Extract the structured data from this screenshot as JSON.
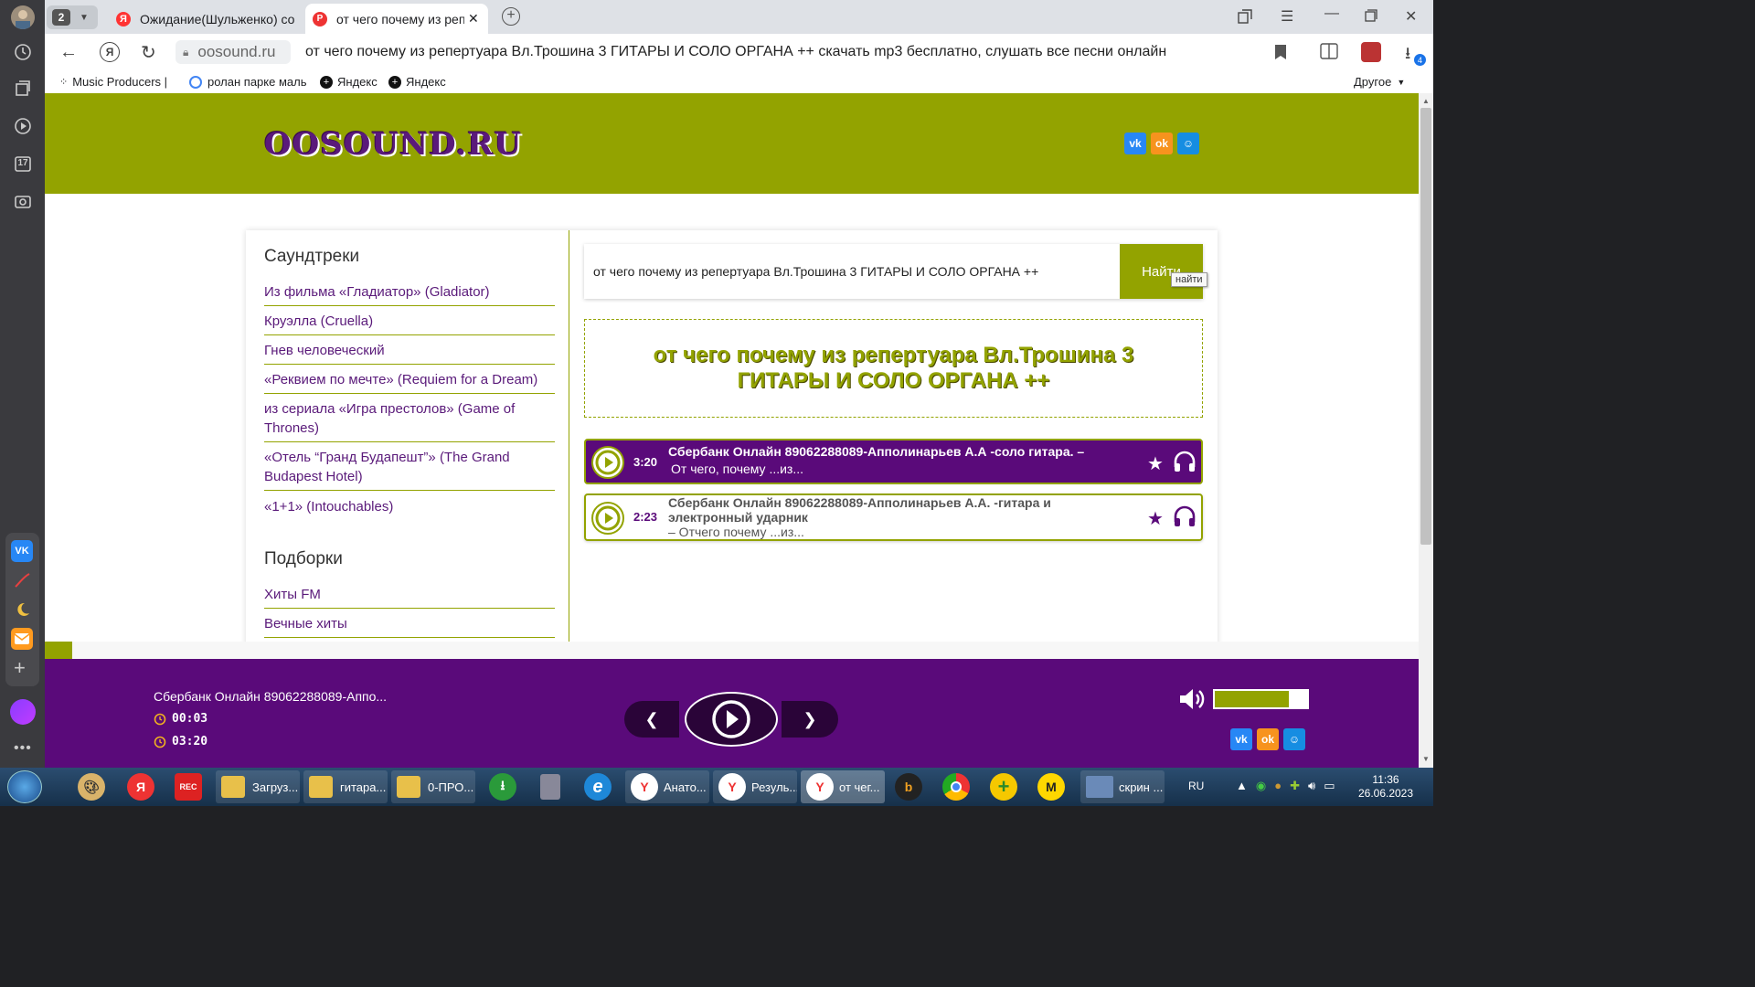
{
  "browser": {
    "tab_count": "2",
    "tabs": [
      {
        "title": "Ожидание(Шульженко) со"
      },
      {
        "title": "от чего почему из репе"
      }
    ],
    "url_domain": "oosound.ru",
    "page_title": "от чего почему из репертуара Вл.Трошина 3 ГИТАРЫ И СОЛО ОРГАНА ++ скачать mp3 бесплатно, слушать все песни онлайн",
    "bookmarks": [
      {
        "label": "Music Producers |"
      },
      {
        "label": "ролан парке маль"
      },
      {
        "label": "Яндекс"
      },
      {
        "label": "Яндекс"
      }
    ],
    "bookmarks_other": "Другое",
    "downloads_badge": "4",
    "sidebar_calendar": "17"
  },
  "site": {
    "logo": "OOSOUND.RU",
    "social": {
      "vk": "vk",
      "ok": "ok",
      "mail": "mail"
    },
    "sections": [
      {
        "title": "Саундтреки",
        "items": [
          "Из фильма «Гладиатор» (Gladiator)",
          "Круэлла (Cruella)",
          "Гнев человеческий",
          "«Реквием по мечте» (Requiem for a Dream)",
          "из сериала «Игра престолов» (Game of Thrones)",
          "«Отель “Гранд Будапешт”» (The Grand Budapest Hotel)",
          "«1+1» (Intouchables)"
        ]
      },
      {
        "title": "Подборки",
        "items": [
          "Хиты FM",
          "Вечные хиты"
        ]
      }
    ],
    "search": {
      "value": "от чего почему из репертуара Вл.Трошина 3 ГИТАРЫ И СОЛО ОРГАНА ++",
      "button": "Найти",
      "tooltip": "найти"
    },
    "heading": "от чего почему из репертуара Вл.Трошина 3 ГИТАРЫ И СОЛО ОРГАНА ++",
    "tracks": [
      {
        "duration": "3:20",
        "title": "Сбербанк Онлайн 89062288089-Апполинарьев А.А -соло гитара. –",
        "subtitle": "От чего, почему ...из...",
        "active": true
      },
      {
        "duration": "2:23",
        "title": "Сбербанк Онлайн 89062288089-Апполинарьев А.А. -гитара и электронный ударник",
        "subtitle": "– Отчего почему ...из...",
        "active": false
      }
    ],
    "player": {
      "now_playing": "Сбербанк Онлайн 89062288089-Аппо...",
      "elapsed": "00:03",
      "total": "03:20",
      "volume_fraction": 0.8
    },
    "colors": {
      "accent": "#93a300",
      "purple": "#5a0a7a"
    }
  },
  "taskbar": {
    "buttons": [
      {
        "label": "Загруз..."
      },
      {
        "label": "гитара..."
      },
      {
        "label": "0-ПРО..."
      },
      {
        "label": "Анато..."
      },
      {
        "label": "Резуль..."
      },
      {
        "label": "от чег..."
      },
      {
        "label": "скрин ..."
      }
    ],
    "language": "RU",
    "time": "11:36",
    "date": "26.06.2023"
  }
}
